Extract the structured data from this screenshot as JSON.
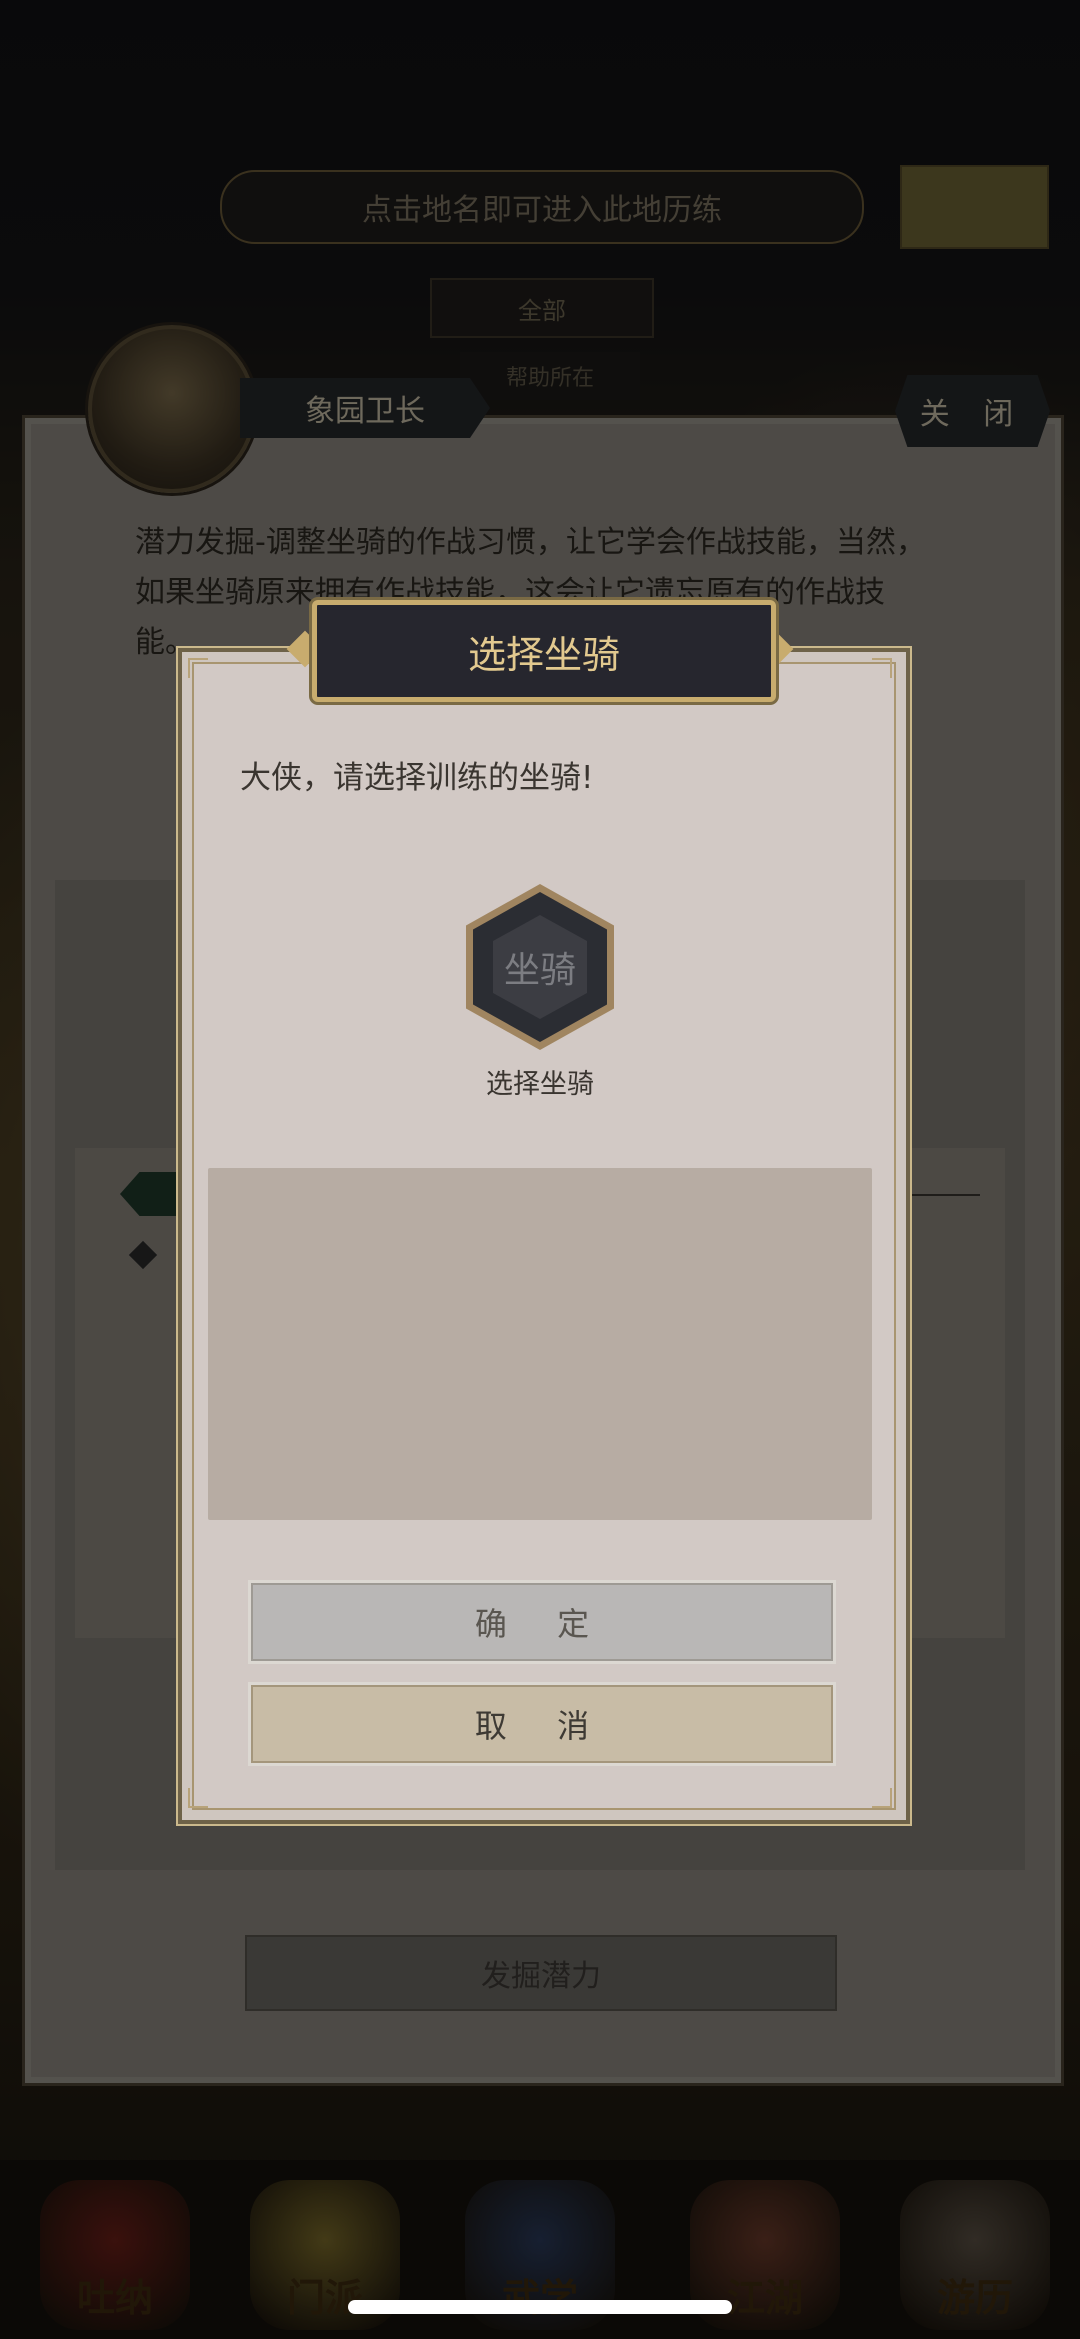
{
  "background": {
    "hint_text": "点击地名即可进入此地历练",
    "filter_label": "全部",
    "sub_label": "帮助所在"
  },
  "npc_panel": {
    "npc_name": "象园卫长",
    "close_label": "关 闭",
    "description": "潜力发掘-调整坐骑的作战习惯，让它学会作战技能，当然，如果坐骑原来拥有作战技能，这会让它遗忘原有的作战技能。",
    "dig_button_label": "发掘潜力"
  },
  "modal": {
    "title": "选择坐骑",
    "prompt": "大侠，请选择训练的坐骑!",
    "slot_placeholder": "坐骑",
    "slot_label": "选择坐骑",
    "confirm_label": "确 定",
    "cancel_label": "取 消"
  },
  "bottom_nav": {
    "items": [
      {
        "label": "吐纳",
        "color": "#6a1f18"
      },
      {
        "label": "门派",
        "color": "#7a6a2a"
      },
      {
        "label": "武学",
        "color": "#2a3a5a"
      },
      {
        "label": "江湖",
        "color": "#6a3a2a"
      },
      {
        "label": "游历",
        "color": "#5a5044"
      }
    ]
  },
  "colors": {
    "accent_gold": "#c8ac6e",
    "modal_bg": "#d2c9c5",
    "title_bg": "#26262e"
  }
}
